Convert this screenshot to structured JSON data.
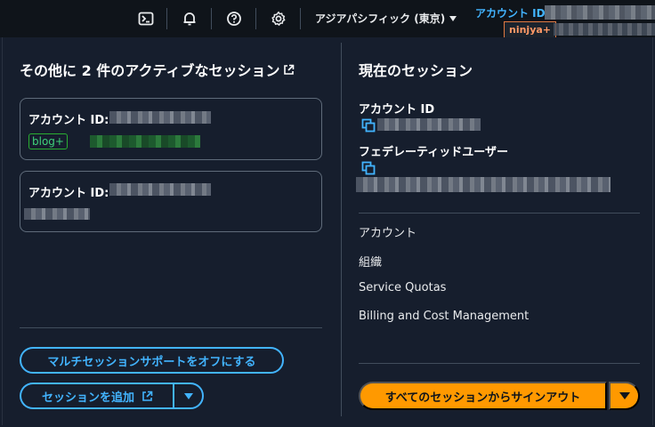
{
  "topbar": {
    "icons": [
      "cloudshell-icon",
      "bell-icon",
      "help-icon",
      "gear-icon"
    ],
    "region": "アジアパシフィック (東京)",
    "account_label": "アカウント ID",
    "session_badge": "ninjya+"
  },
  "left": {
    "heading": "その他に 2 件のアクティブなセッション",
    "cards": [
      {
        "label": "アカウント ID:",
        "badge": "blog+"
      },
      {
        "label": "アカウント ID:"
      }
    ],
    "multi_session_off": "マルチセッションサポートをオフにする",
    "add_session": "セッションを追加"
  },
  "right": {
    "heading": "現在のセッション",
    "account_id_label": "アカウント ID",
    "federated_user_label": "フェデレーティッドユーザー",
    "menu": [
      "アカウント",
      "組織",
      "Service Quotas",
      "Billing and Cost Management"
    ],
    "signout_all": "すべてのセッションからサインアウト"
  },
  "colors": {
    "accent_blue": "#42b4ff",
    "primary_orange": "#ff9900",
    "badge_green": "#29ad32",
    "session_orange": "#e07941",
    "background": "#161e2d"
  }
}
